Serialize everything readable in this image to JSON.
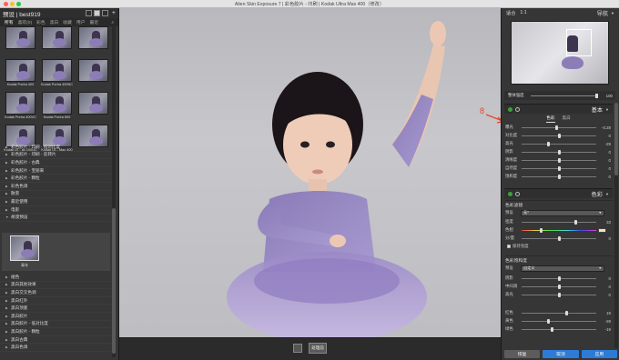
{
  "window": {
    "title": "Alien Skin Exposure 7 | 彩色胶片 - 印刷 | Kodak Ultra Max 400（修改）",
    "traffic_colors": [
      "#ff5f57",
      "#febc2e",
      "#28c840"
    ]
  },
  "left_panel": {
    "header_label": "预设 | best919",
    "tabs": [
      "所有",
      "喜欢(0)",
      "彩色",
      "黑白",
      "收藏",
      "用户",
      "最近"
    ],
    "thumbnails": [
      {
        "label": ""
      },
      {
        "label": ""
      },
      {
        "label": ""
      },
      {
        "label": "Kodak Portra 400"
      },
      {
        "label": "Kodak Portra 400NC"
      },
      {
        "label": ""
      },
      {
        "label": "Kodak Portra 400VC"
      },
      {
        "label": "Kodak Portra 800"
      },
      {
        "label": ""
      },
      {
        "label": "Kodak Ul... ax 100UC"
      },
      {
        "label": "Kodak Ul... Max 400"
      },
      {
        "label": ""
      }
    ],
    "categories": [
      "彩色胶片 - 印刷 - 低对比度",
      "彩色胶片 - 印刷 - 反转片",
      "彩色胶片 - 古典",
      "彩色胶片 - 宝丽来",
      "彩色胶片 - 颗粒",
      "彩色色调",
      "散景",
      "最近使用",
      "电影",
      "胡漠预设"
    ],
    "selected_preset": {
      "label": "青年"
    },
    "categories_bottom": [
      "褪色",
      "黑白其他效果",
      "黑白交叉色调",
      "黑白红外",
      "黑白顶底",
      "黑白胶片",
      "黑白胶片 - 低对比度",
      "黑白胶片 - 颗粒",
      "黑白古典",
      "黑白色调"
    ]
  },
  "bottom_bar": {
    "button_label": "处理前"
  },
  "annotation": {
    "number": "8",
    "color": "#e8452a"
  },
  "right_panel": {
    "top": {
      "fit_label": "适合",
      "ratio_label": "1:1",
      "navigator_label": "导航"
    },
    "opacity": {
      "label": "整体强度",
      "value": "100"
    },
    "basic": {
      "title": "基本",
      "subtabs": [
        "色彩",
        "黑白"
      ],
      "rows": [
        {
          "label": "曝光",
          "value": "-0.28"
        },
        {
          "label": "对比度",
          "value": "0"
        },
        {
          "label": "高光",
          "value": "-29"
        },
        {
          "label": "阴影",
          "value": "0"
        },
        {
          "label": "清晰度",
          "value": "0"
        },
        {
          "label": "自然度",
          "value": "0"
        },
        {
          "label": "饱和度",
          "value": "0"
        }
      ]
    },
    "color": {
      "title": "色彩",
      "filter_title": "色彩滤镜",
      "preset_label": "预设",
      "preset_value": "无*",
      "rows": [
        {
          "label": "密度",
          "value": "33"
        },
        {
          "label": "色相",
          "value": ""
        },
        {
          "label": "分/量",
          "value": "0"
        }
      ],
      "keep_brightness": "保持亮度",
      "saturation_title": "色彩饱和度",
      "sat_preset_label": "预设",
      "sat_preset_value": "自定义",
      "sat_rows": [
        {
          "label": "阴影",
          "value": "0"
        },
        {
          "label": "中间调",
          "value": "0"
        },
        {
          "label": "高光",
          "value": "0"
        }
      ],
      "color_rows": [
        {
          "label": "红色",
          "value": "19"
        },
        {
          "label": "黄色",
          "value": "-28"
        },
        {
          "label": "绿色",
          "value": "-19"
        }
      ],
      "swatch_color": "#efe3c2"
    },
    "buttons": {
      "reset": "恢复",
      "cancel": "取消",
      "apply": "应用"
    }
  }
}
